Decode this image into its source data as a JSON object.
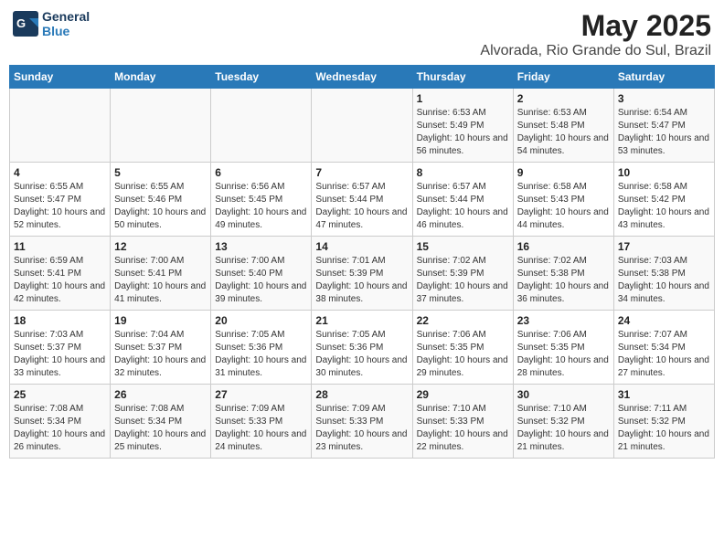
{
  "header": {
    "logo_line1": "General",
    "logo_line2": "Blue",
    "title": "May 2025",
    "subtitle": "Alvorada, Rio Grande do Sul, Brazil"
  },
  "calendar": {
    "weekdays": [
      "Sunday",
      "Monday",
      "Tuesday",
      "Wednesday",
      "Thursday",
      "Friday",
      "Saturday"
    ],
    "weeks": [
      [
        {
          "day": "",
          "sunrise": "",
          "sunset": "",
          "daylight": ""
        },
        {
          "day": "",
          "sunrise": "",
          "sunset": "",
          "daylight": ""
        },
        {
          "day": "",
          "sunrise": "",
          "sunset": "",
          "daylight": ""
        },
        {
          "day": "",
          "sunrise": "",
          "sunset": "",
          "daylight": ""
        },
        {
          "day": "1",
          "sunrise": "Sunrise: 6:53 AM",
          "sunset": "Sunset: 5:49 PM",
          "daylight": "Daylight: 10 hours and 56 minutes."
        },
        {
          "day": "2",
          "sunrise": "Sunrise: 6:53 AM",
          "sunset": "Sunset: 5:48 PM",
          "daylight": "Daylight: 10 hours and 54 minutes."
        },
        {
          "day": "3",
          "sunrise": "Sunrise: 6:54 AM",
          "sunset": "Sunset: 5:47 PM",
          "daylight": "Daylight: 10 hours and 53 minutes."
        }
      ],
      [
        {
          "day": "4",
          "sunrise": "Sunrise: 6:55 AM",
          "sunset": "Sunset: 5:47 PM",
          "daylight": "Daylight: 10 hours and 52 minutes."
        },
        {
          "day": "5",
          "sunrise": "Sunrise: 6:55 AM",
          "sunset": "Sunset: 5:46 PM",
          "daylight": "Daylight: 10 hours and 50 minutes."
        },
        {
          "day": "6",
          "sunrise": "Sunrise: 6:56 AM",
          "sunset": "Sunset: 5:45 PM",
          "daylight": "Daylight: 10 hours and 49 minutes."
        },
        {
          "day": "7",
          "sunrise": "Sunrise: 6:57 AM",
          "sunset": "Sunset: 5:44 PM",
          "daylight": "Daylight: 10 hours and 47 minutes."
        },
        {
          "day": "8",
          "sunrise": "Sunrise: 6:57 AM",
          "sunset": "Sunset: 5:44 PM",
          "daylight": "Daylight: 10 hours and 46 minutes."
        },
        {
          "day": "9",
          "sunrise": "Sunrise: 6:58 AM",
          "sunset": "Sunset: 5:43 PM",
          "daylight": "Daylight: 10 hours and 44 minutes."
        },
        {
          "day": "10",
          "sunrise": "Sunrise: 6:58 AM",
          "sunset": "Sunset: 5:42 PM",
          "daylight": "Daylight: 10 hours and 43 minutes."
        }
      ],
      [
        {
          "day": "11",
          "sunrise": "Sunrise: 6:59 AM",
          "sunset": "Sunset: 5:41 PM",
          "daylight": "Daylight: 10 hours and 42 minutes."
        },
        {
          "day": "12",
          "sunrise": "Sunrise: 7:00 AM",
          "sunset": "Sunset: 5:41 PM",
          "daylight": "Daylight: 10 hours and 41 minutes."
        },
        {
          "day": "13",
          "sunrise": "Sunrise: 7:00 AM",
          "sunset": "Sunset: 5:40 PM",
          "daylight": "Daylight: 10 hours and 39 minutes."
        },
        {
          "day": "14",
          "sunrise": "Sunrise: 7:01 AM",
          "sunset": "Sunset: 5:39 PM",
          "daylight": "Daylight: 10 hours and 38 minutes."
        },
        {
          "day": "15",
          "sunrise": "Sunrise: 7:02 AM",
          "sunset": "Sunset: 5:39 PM",
          "daylight": "Daylight: 10 hours and 37 minutes."
        },
        {
          "day": "16",
          "sunrise": "Sunrise: 7:02 AM",
          "sunset": "Sunset: 5:38 PM",
          "daylight": "Daylight: 10 hours and 36 minutes."
        },
        {
          "day": "17",
          "sunrise": "Sunrise: 7:03 AM",
          "sunset": "Sunset: 5:38 PM",
          "daylight": "Daylight: 10 hours and 34 minutes."
        }
      ],
      [
        {
          "day": "18",
          "sunrise": "Sunrise: 7:03 AM",
          "sunset": "Sunset: 5:37 PM",
          "daylight": "Daylight: 10 hours and 33 minutes."
        },
        {
          "day": "19",
          "sunrise": "Sunrise: 7:04 AM",
          "sunset": "Sunset: 5:37 PM",
          "daylight": "Daylight: 10 hours and 32 minutes."
        },
        {
          "day": "20",
          "sunrise": "Sunrise: 7:05 AM",
          "sunset": "Sunset: 5:36 PM",
          "daylight": "Daylight: 10 hours and 31 minutes."
        },
        {
          "day": "21",
          "sunrise": "Sunrise: 7:05 AM",
          "sunset": "Sunset: 5:36 PM",
          "daylight": "Daylight: 10 hours and 30 minutes."
        },
        {
          "day": "22",
          "sunrise": "Sunrise: 7:06 AM",
          "sunset": "Sunset: 5:35 PM",
          "daylight": "Daylight: 10 hours and 29 minutes."
        },
        {
          "day": "23",
          "sunrise": "Sunrise: 7:06 AM",
          "sunset": "Sunset: 5:35 PM",
          "daylight": "Daylight: 10 hours and 28 minutes."
        },
        {
          "day": "24",
          "sunrise": "Sunrise: 7:07 AM",
          "sunset": "Sunset: 5:34 PM",
          "daylight": "Daylight: 10 hours and 27 minutes."
        }
      ],
      [
        {
          "day": "25",
          "sunrise": "Sunrise: 7:08 AM",
          "sunset": "Sunset: 5:34 PM",
          "daylight": "Daylight: 10 hours and 26 minutes."
        },
        {
          "day": "26",
          "sunrise": "Sunrise: 7:08 AM",
          "sunset": "Sunset: 5:34 PM",
          "daylight": "Daylight: 10 hours and 25 minutes."
        },
        {
          "day": "27",
          "sunrise": "Sunrise: 7:09 AM",
          "sunset": "Sunset: 5:33 PM",
          "daylight": "Daylight: 10 hours and 24 minutes."
        },
        {
          "day": "28",
          "sunrise": "Sunrise: 7:09 AM",
          "sunset": "Sunset: 5:33 PM",
          "daylight": "Daylight: 10 hours and 23 minutes."
        },
        {
          "day": "29",
          "sunrise": "Sunrise: 7:10 AM",
          "sunset": "Sunset: 5:33 PM",
          "daylight": "Daylight: 10 hours and 22 minutes."
        },
        {
          "day": "30",
          "sunrise": "Sunrise: 7:10 AM",
          "sunset": "Sunset: 5:32 PM",
          "daylight": "Daylight: 10 hours and 21 minutes."
        },
        {
          "day": "31",
          "sunrise": "Sunrise: 7:11 AM",
          "sunset": "Sunset: 5:32 PM",
          "daylight": "Daylight: 10 hours and 21 minutes."
        }
      ]
    ]
  }
}
